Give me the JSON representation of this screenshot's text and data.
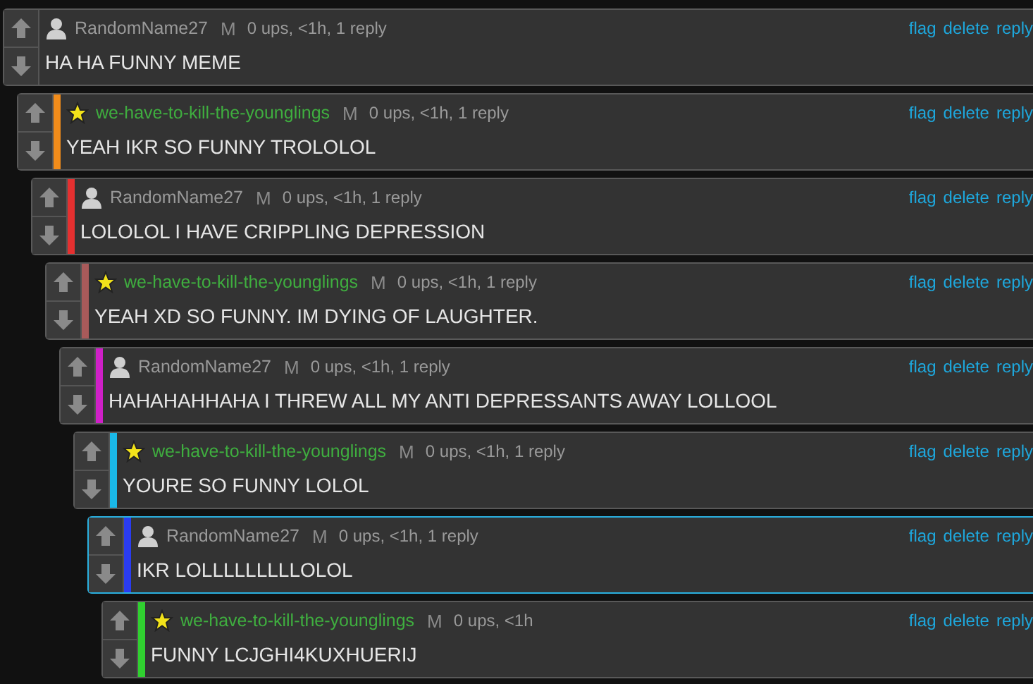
{
  "comments": [
    {
      "kind": "person",
      "author": "RandomName27",
      "mod": "M",
      "meta": "0 ups, <1h, 1 reply",
      "text": "HA HA FUNNY MEME",
      "highlighted": false,
      "actions": [
        "flag",
        "delete",
        "reply"
      ],
      "children": [
        {
          "kind": "star",
          "author": "we-have-to-kill-the-younglings",
          "mod": "M",
          "meta": "0 ups, <1h, 1 reply",
          "text": "YEAH IKR SO FUNNY TROLOLOL",
          "color": "#f28c1a",
          "highlighted": false,
          "actions": [
            "flag",
            "delete",
            "reply"
          ],
          "children": [
            {
              "kind": "person",
              "author": "RandomName27",
              "mod": "M",
              "meta": "0 ups, <1h, 1 reply",
              "text": "LOLOLOL I HAVE CRIPPLING DEPRESSION",
              "color": "#e53030",
              "highlighted": false,
              "actions": [
                "flag",
                "delete",
                "reply"
              ],
              "children": [
                {
                  "kind": "star",
                  "author": "we-have-to-kill-the-younglings",
                  "mod": "M",
                  "meta": "0 ups, <1h, 1 reply",
                  "text": "YEAH XD SO FUNNY. IM DYING OF LAUGHTER.",
                  "color": "#a85a5a",
                  "highlighted": false,
                  "actions": [
                    "flag",
                    "delete",
                    "reply"
                  ],
                  "children": [
                    {
                      "kind": "person",
                      "author": "RandomName27",
                      "mod": "M",
                      "meta": "0 ups, <1h, 1 reply",
                      "text": "HAHAHAHHAHA I THREW ALL MY ANTI DEPRESSANTS AWAY LOLLOOL",
                      "color": "#d020c8",
                      "highlighted": false,
                      "actions": [
                        "flag",
                        "delete",
                        "reply"
                      ],
                      "children": [
                        {
                          "kind": "star",
                          "author": "we-have-to-kill-the-younglings",
                          "mod": "M",
                          "meta": "0 ups, <1h, 1 reply",
                          "text": "YOURE SO FUNNY LOLOL",
                          "color": "#1ab8e8",
                          "highlighted": false,
                          "actions": [
                            "flag",
                            "delete",
                            "reply"
                          ],
                          "children": [
                            {
                              "kind": "person",
                              "author": "RandomName27",
                              "mod": "M",
                              "meta": "0 ups, <1h, 1 reply",
                              "text": "IKR LOLLLLLLLLLOLOL",
                              "color": "#2a3cf0",
                              "highlighted": true,
                              "actions": [
                                "flag",
                                "delete",
                                "reply"
                              ],
                              "children": [
                                {
                                  "kind": "star",
                                  "author": "we-have-to-kill-the-younglings",
                                  "mod": "M",
                                  "meta": "0 ups, <1h",
                                  "text": "FUNNY LCJGHI4KUXHUERIJ",
                                  "color": "#30d030",
                                  "highlighted": false,
                                  "actions": [
                                    "flag",
                                    "delete",
                                    "reply"
                                  ]
                                }
                              ]
                            }
                          ]
                        }
                      ]
                    }
                  ]
                }
              ]
            }
          ]
        }
      ]
    }
  ]
}
